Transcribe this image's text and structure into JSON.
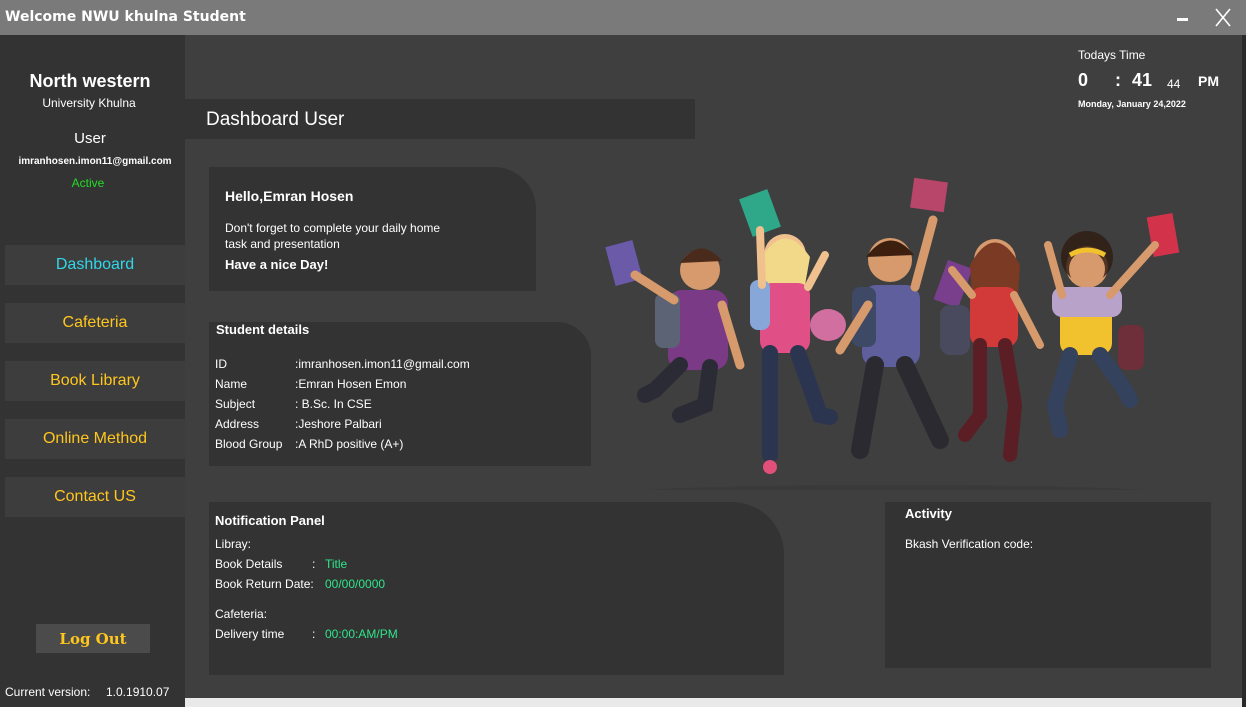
{
  "titlebar": {
    "title": "Welcome NWU khulna Student",
    "minimize": "minimize",
    "close": "close"
  },
  "sidebar": {
    "brand_line1": "North western",
    "brand_line2": "University Khulna",
    "role": "User",
    "email": "imranhosen.imon11@gmail.com",
    "status": "Active",
    "nav": [
      {
        "label": "Dashboard",
        "active": true
      },
      {
        "label": "Cafeteria",
        "active": false
      },
      {
        "label": "Book Library",
        "active": false
      },
      {
        "label": "Online Method",
        "active": false
      },
      {
        "label": "Contact US",
        "active": false
      }
    ],
    "logout_label": "Log Out",
    "version_label": "Current version:",
    "version_value": "1.0.1910.07"
  },
  "header": {
    "title": "Dashboard User"
  },
  "clock": {
    "label": "Todays Time",
    "hour": "0",
    "sep": ":",
    "minute": "41",
    "second": "44",
    "ampm": "PM",
    "date": "Monday, January 24,2022"
  },
  "hello": {
    "greeting": "Hello,Emran Hosen",
    "line1": "Don't forget to complete your daily home",
    "line2": "task and presentation",
    "line3": "Have a nice Day!"
  },
  "details": {
    "title": "Student details",
    "rows": [
      {
        "label": "ID",
        "value": ":imranhosen.imon11@gmail.com"
      },
      {
        "label": "Name",
        "value": ":Emran Hosen Emon"
      },
      {
        "label": "Subject",
        "value": ": B.Sc. In CSE"
      },
      {
        "label": "Address",
        "value": ":Jeshore Palbari"
      },
      {
        "label": "Blood Group",
        "value": ":A RhD positive (A+)"
      }
    ]
  },
  "notification": {
    "title": "Notification Panel",
    "library_label": "Libray:",
    "book_details_label": "Book Details",
    "book_details_sep": ":",
    "book_details_value": "Title",
    "book_return_label": "Book Return Date:",
    "book_return_value": "00/00/0000",
    "cafeteria_label": "Cafeteria:",
    "delivery_label": "Delivery time",
    "delivery_sep": ":",
    "delivery_value": "00:00:AM/PM"
  },
  "activity": {
    "title": "Activity",
    "bkash_label": "Bkash Verification code:"
  },
  "colors": {
    "accent_active": "#2fd8ea",
    "nav_text": "#ffc61e",
    "status_green": "#22dd22",
    "value_green": "#2ee58a"
  },
  "illustration": {
    "name": "students-jumping-illustration"
  }
}
